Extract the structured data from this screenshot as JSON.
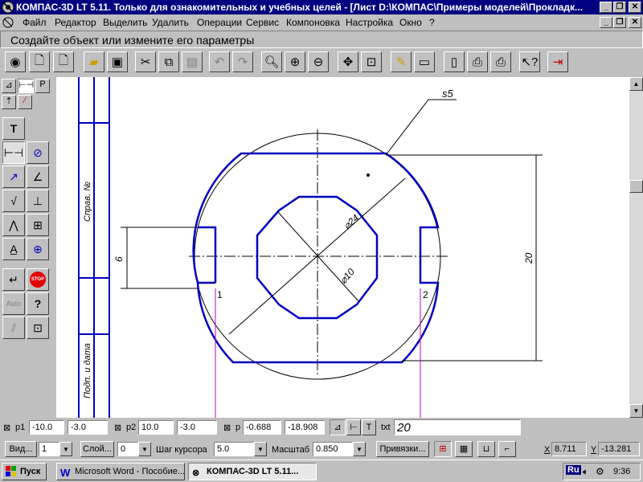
{
  "window": {
    "title": "КОМПАС-3D LT 5.11. Только для ознакомительных и учебных целей - [Лист D:\\КОМПАС\\Примеры моделей\\Прокладк..."
  },
  "menu": [
    "Файл",
    "Редактор",
    "Выделить",
    "Удалить",
    "Операции",
    "Сервис",
    "Компоновка",
    "Настройка",
    "Окно",
    "?"
  ],
  "prompt": "Создайте объект или измените его параметры",
  "toolbar_icons": [
    "camera-icon",
    "new-file-icon",
    "new-sheet-icon",
    "open-folder-icon",
    "save-icon",
    "cut-icon",
    "copy-icon",
    "paste-icon",
    "undo-icon",
    "redo-icon",
    "zoom-icon",
    "zoom-in-icon",
    "zoom-out-icon",
    "pan-icon",
    "zoom-fit-icon",
    "edit-pen-icon",
    "layers-icon",
    "page-icon",
    "print-preview-icon",
    "print-icon",
    "help-cursor-icon",
    "exit-icon"
  ],
  "left_tabs": [
    "P"
  ],
  "drawing": {
    "labels": {
      "surface": "s5",
      "dia_outer": "⌀24",
      "dia_inner": "⌀10",
      "dim_height": "20",
      "dim_slot": "6",
      "point1": "1",
      "point2": "2",
      "frame_text1": "Справ. №",
      "frame_text2": "Подп. и дата"
    }
  },
  "coords": {
    "p1_label": "p1",
    "p1_x": "-10.0",
    "p1_y": "-3.0",
    "p2_label": "p2",
    "p2_x": "10.0",
    "p2_y": "-3.0",
    "pt_label": "p",
    "pt_x": "-0.688",
    "pt_y": "-18.908",
    "txt_label": "txt",
    "txt_value": "20"
  },
  "status": {
    "view_label": "Вид...",
    "view_value": "1",
    "layer_label": "Слой...",
    "layer_value": "0",
    "step_label": "Шаг курсора",
    "step_value": "5.0",
    "scale_label": "Масштаб",
    "scale_value": "0.850",
    "snaps_label": "Привязки...",
    "x_label": "X",
    "x_value": "8.711",
    "y_label": "Y",
    "y_value": "-13.281"
  },
  "taskbar": {
    "start": "Пуск",
    "tasks": [
      "Microsoft Word - Пособие...",
      "КОМПАС-3D LT 5.11..."
    ],
    "lang": "Ru",
    "time": "9:36"
  },
  "colors": {
    "title": "#000080",
    "geometry": "#0000c0",
    "aux": "#c000c0"
  }
}
